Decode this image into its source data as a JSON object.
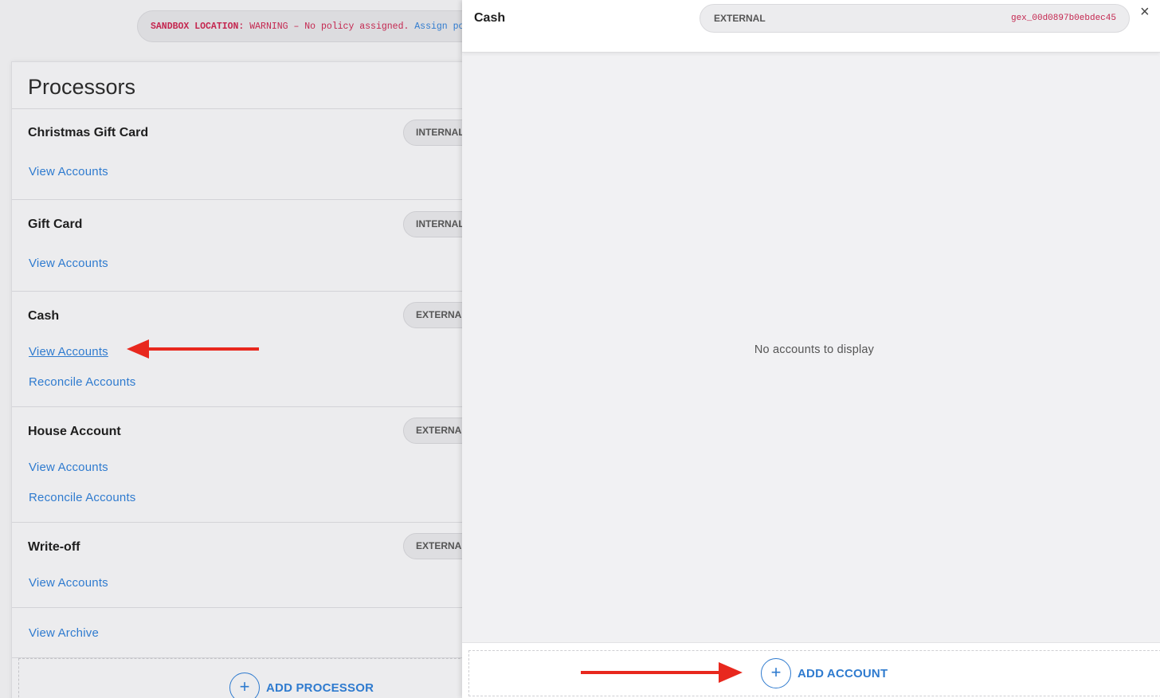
{
  "sandbox_banner": {
    "label": "SANDBOX LOCATION:",
    "warning": "WARNING – No policy assigned.",
    "link": "Assign policy"
  },
  "processors": {
    "title": "Processors",
    "items": [
      {
        "name": "Christmas Gift Card",
        "type": "INTERNAL",
        "view_label": "View Accounts"
      },
      {
        "name": "Gift Card",
        "type": "INTERNAL",
        "view_label": "View Accounts"
      },
      {
        "name": "Cash",
        "type": "EXTERNAL",
        "view_label": "View Accounts",
        "reconcile_label": "Reconcile Accounts"
      },
      {
        "name": "House Account",
        "type": "EXTERNAL",
        "view_label": "View Accounts",
        "reconcile_label": "Reconcile Accounts"
      },
      {
        "name": "Write-off",
        "type": "EXTERNAL",
        "view_label": "View Accounts"
      }
    ],
    "view_archive_label": "View Archive",
    "add_label": "ADD PROCESSOR"
  },
  "drawer": {
    "title": "Cash",
    "type": "EXTERNAL",
    "id": "gex_00d0897b0ebdec45",
    "close": "×",
    "empty_message": "No accounts to display",
    "add_label": "ADD ACCOUNT",
    "plus": "+"
  },
  "colors": {
    "link": "#2f7bcf",
    "accent_red": "#c4264f",
    "annotation_arrow": "#e8281e"
  }
}
